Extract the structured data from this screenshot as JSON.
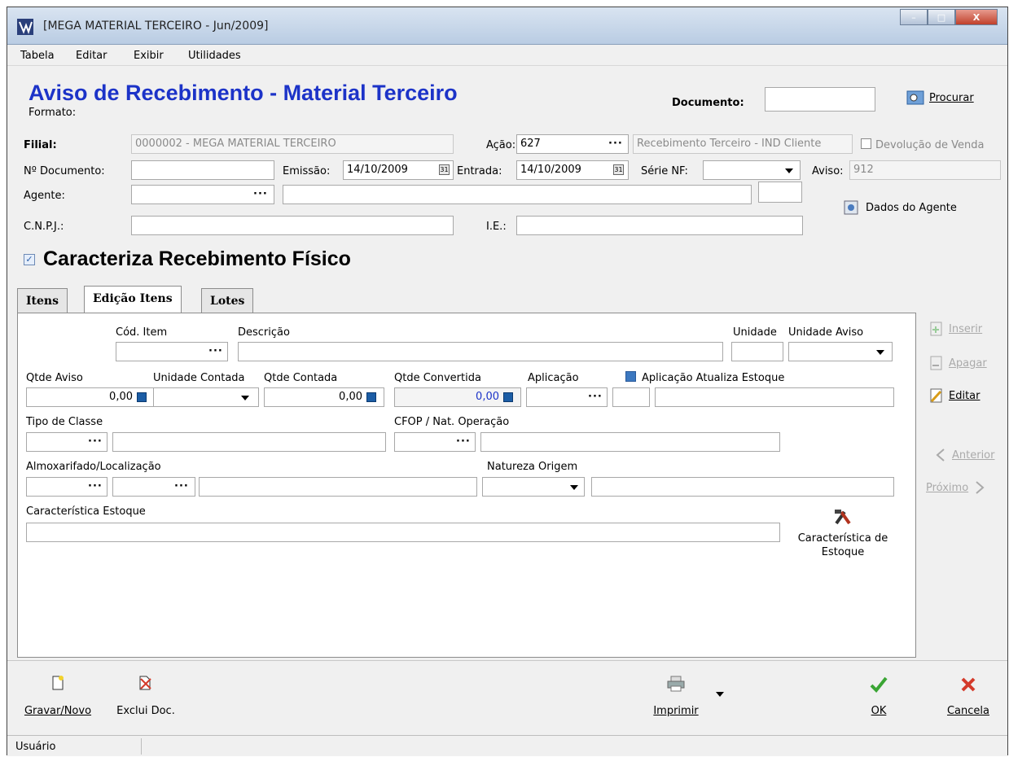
{
  "window": {
    "title": "[MEGA MATERIAL TERCEIRO - Jun/2009]",
    "minimize": "–",
    "maximize": "□",
    "close": "X"
  },
  "menu": [
    "Tabela",
    "Editar",
    "Exibir",
    "Utilidades"
  ],
  "header": {
    "title": "Aviso de Recebimento - Material Terceiro",
    "formato_label": "Formato:",
    "documento_label": "Documento:",
    "documento_value": "",
    "procurar_label": "Procurar"
  },
  "form": {
    "filial_label": "Filial:",
    "filial_value": "0000002 - MEGA MATERIAL TERCEIRO",
    "acao_label": "Ação:",
    "acao_value": "627",
    "acao_desc": "Recebimento Terceiro - IND Cliente",
    "devolucao_label": "Devolução de Venda",
    "ndoc_label": "Nº Documento:",
    "ndoc_value": "",
    "emissao_label": "Emissão:",
    "emissao_value": "14/10/2009",
    "entrada_label": "Entrada:",
    "entrada_value": "14/10/2009",
    "serie_label": "Série NF:",
    "serie_value": "",
    "aviso_label": "Aviso:",
    "aviso_value": "912",
    "agente_label": "Agente:",
    "cnpj_label": "C.N.P.J.:",
    "ie_label": "I.E.:",
    "dados_agente": "Dados do Agente",
    "caracteriza_label": "Caracteriza Recebimento Físico",
    "dots": "···"
  },
  "tabs": [
    "Itens",
    "Edição Itens",
    "Lotes"
  ],
  "edicao": {
    "cod_item": "Cód. Item",
    "descricao": "Descrição",
    "unidade": "Unidade",
    "unidade_aviso": "Unidade Aviso",
    "qtde_aviso": "Qtde Aviso",
    "qtde_aviso_value": "0,00",
    "unidade_contada": "Unidade Contada",
    "qtde_contada": "Qtde Contada",
    "qtde_contada_value": "0,00",
    "qtde_convertida": "Qtde Convertida",
    "qtde_convertida_value": "0,00",
    "aplicacao": "Aplicação",
    "aplicacao_atualiza": "Aplicação Atualiza Estoque",
    "tipo_classe": "Tipo de Classe",
    "cfop": "CFOP / Nat. Operação",
    "almox": "Almoxarifado/Localização",
    "natureza_origem": "Natureza Origem",
    "caracteristica_estoque": "Característica Estoque",
    "caracteristica_btn_1": "Característica de",
    "caracteristica_btn_2": "Estoque"
  },
  "side": {
    "inserir": "Inserir",
    "apagar": "Apagar",
    "editar": "Editar",
    "anterior": "Anterior",
    "proximo": "Próximo"
  },
  "bottom": {
    "gravar": "Gravar/Novo",
    "exclui": "Exclui Doc.",
    "imprimir": "Imprimir",
    "ok": "OK",
    "cancela": "Cancela"
  },
  "status": {
    "usuario": "Usuário"
  },
  "colors": {
    "heading": "#1c33c8",
    "ok": "#3aa534",
    "cancel": "#d43a2a"
  }
}
